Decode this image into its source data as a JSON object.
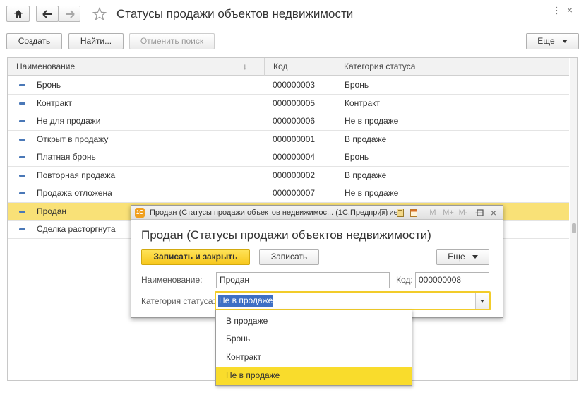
{
  "window": {
    "title": "Статусы продажи объектов недвижимости",
    "nav": {
      "home_icon": "home-icon",
      "back_icon": "arrow-left-icon",
      "forward_icon": "arrow-right-icon",
      "favorite_icon": "star-icon"
    },
    "menu_icons": [
      "dots-icon",
      "close-icon"
    ]
  },
  "toolbar": {
    "create_label": "Создать",
    "find_label": "Найти...",
    "cancel_search_label": "Отменить поиск",
    "more_label": "Еще"
  },
  "table": {
    "columns": [
      {
        "label": "Наименование",
        "sort_icon": "↓"
      },
      {
        "label": "Код"
      },
      {
        "label": "Категория статуса"
      }
    ],
    "rows": [
      {
        "name": "Бронь",
        "code": "000000003",
        "category": "Бронь"
      },
      {
        "name": "Контракт",
        "code": "000000005",
        "category": "Контракт"
      },
      {
        "name": "Не для продажи",
        "code": "000000006",
        "category": "Не в продаже"
      },
      {
        "name": "Открыт в продажу",
        "code": "000000001",
        "category": "В продаже"
      },
      {
        "name": "Платная бронь",
        "code": "000000004",
        "category": "Бронь"
      },
      {
        "name": "Повторная продажа",
        "code": "000000002",
        "category": "В продаже"
      },
      {
        "name": "Продажа отложена",
        "code": "000000007",
        "category": "Не в продаже"
      },
      {
        "name": "Продан",
        "code": "",
        "category": "",
        "selected": true
      },
      {
        "name": "Сделка расторгнута",
        "code": "",
        "category": ""
      }
    ]
  },
  "dialog": {
    "window_title": "Продан (Статусы продажи объектов недвижимос... (1С:Предприятие)",
    "app_icon_text": "1С",
    "title_icons": [
      "M",
      "M+",
      "M-"
    ],
    "heading": "Продан (Статусы продажи объектов недвижимости)",
    "save_close_label": "Записать и закрыть",
    "save_label": "Записать",
    "more_label": "Еще",
    "name_label": "Наименование:",
    "name_value": "Продан",
    "code_label": "Код:",
    "code_value": "000000008",
    "category_label": "Категория статуса:",
    "category_value": "Не в продаже",
    "category_options": [
      "В продаже",
      "Бронь",
      "Контракт",
      "Не в продаже"
    ],
    "category_selected_index": 3
  },
  "colors": {
    "selected_row": "#f9e177",
    "accent_yellow": "#f9dc2c",
    "row_icon": "#4a78b7"
  }
}
